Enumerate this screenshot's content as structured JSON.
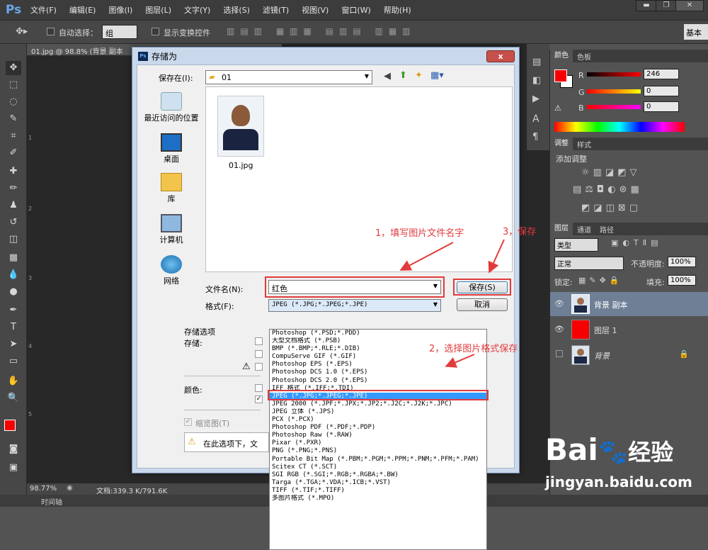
{
  "app": {
    "logo": "Ps",
    "menus": [
      "文件(F)",
      "编辑(E)",
      "图像(I)",
      "图层(L)",
      "文字(Y)",
      "选择(S)",
      "滤镜(T)",
      "视图(V)",
      "窗口(W)",
      "帮助(H)"
    ],
    "window_buttons": [
      "▬",
      "❐",
      "✕"
    ]
  },
  "options": {
    "auto_select_label": "自动选择：",
    "auto_select_value": "组",
    "show_transform_label": "显示变换控件",
    "workspace": "基本"
  },
  "document": {
    "tab": "01.jpg @ 98.8% (背景 副本"
  },
  "toolbox": {
    "ruler_marks": [
      "1",
      "2",
      "3",
      "4",
      "5"
    ]
  },
  "status": {
    "zoom": "98.77%",
    "doc": "文档:339.3 K/791.6K",
    "timeline": "时间轴"
  },
  "color_panel": {
    "tabs": [
      "颜色",
      "色板"
    ],
    "r_label": "R",
    "g_label": "G",
    "b_label": "B",
    "r": "246",
    "g": "0",
    "b": "0",
    "fg": "#f60000",
    "bg": "#ffffff"
  },
  "adjust_panel": {
    "tabs": [
      "调整",
      "样式"
    ],
    "title": "添加调整"
  },
  "layers_panel": {
    "tabs": [
      "图层",
      "通道",
      "路径"
    ],
    "kind": "类型",
    "blend": "正常",
    "opacity_label": "不透明度:",
    "opacity": "100%",
    "lock_label": "锁定:",
    "fill_label": "填充:",
    "fill": "100%",
    "layers": [
      {
        "name": "背景 副本"
      },
      {
        "name": "图层 1"
      },
      {
        "name": "背景"
      }
    ]
  },
  "dialog": {
    "icon": "Ps",
    "title": "存储为",
    "close": "x",
    "save_in_label": "保存在(I):",
    "save_in_value": "01",
    "places": [
      "最近访问的位置",
      "桌面",
      "库",
      "计算机",
      "网络"
    ],
    "file": {
      "name": "01.jpg"
    },
    "filename_label": "文件名(N):",
    "filename_value": "红色",
    "format_label": "格式(F):",
    "format_value": "JPEG (*.JPG;*.JPEG;*.JPE)",
    "save_button": "保存(S)",
    "cancel_button": "取消",
    "options_title": "存储选项",
    "store_label": "存储:",
    "color_label": "颜色:",
    "thumbnail_label": "缩览图(T)",
    "warning_text": "在此选项下，文",
    "format_options": [
      "Photoshop (*.PSD;*.PDD)",
      "大型文档格式 (*.PSB)",
      "BMP (*.BMP;*.RLE;*.DIB)",
      "CompuServe GIF (*.GIF)",
      "Photoshop EPS (*.EPS)",
      "Photoshop DCS 1.0 (*.EPS)",
      "Photoshop DCS 2.0 (*.EPS)",
      "IFF 格式 (*.IFF;*.TDI)",
      "JPEG (*.JPG;*.JPEG;*.JPE)",
      "JPEG 2000 (*.JPF;*.JPX;*.JP2;*.J2C;*.J2K;*.JPC)",
      "JPEG 立体 (*.JPS)",
      "PCX (*.PCX)",
      "Photoshop PDF (*.PDF;*.PDP)",
      "Photoshop Raw (*.RAW)",
      "Pixar (*.PXR)",
      "PNG (*.PNG;*.PNS)",
      "Portable Bit Map (*.PBM;*.PGM;*.PPM;*.PNM;*.PFM;*.PAM)",
      "Scitex CT (*.SCT)",
      "SGI RGB (*.SGI;*.RGB;*.RGBA;*.BW)",
      "Targa (*.TGA;*.VDA;*.ICB;*.VST)",
      "TIFF (*.TIF;*.TIFF)",
      "多图片格式 (*.MPO)"
    ],
    "selected_index": 8
  },
  "annotations": {
    "step1": "1，填写图片文件名字",
    "step2": "2，选择图片格式保存",
    "step3": "3，保存"
  },
  "watermark": {
    "brand": "Bai",
    "brand2": "经验",
    "url": "jingyan.baidu.com"
  }
}
